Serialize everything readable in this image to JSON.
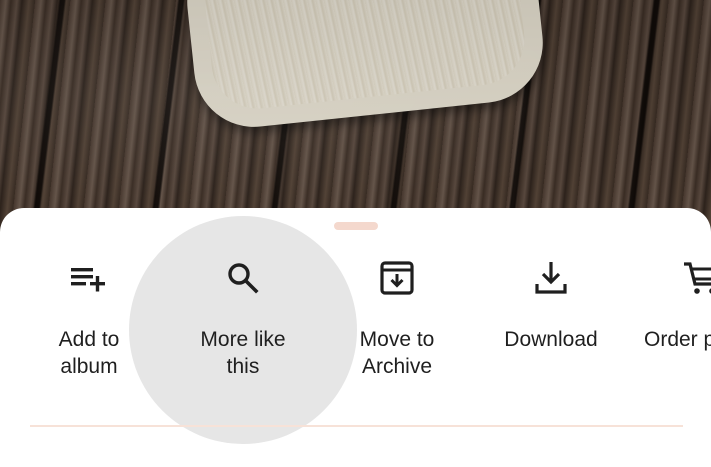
{
  "photo": {
    "description_icon": "photo-preview"
  },
  "sheet": {
    "actions": [
      {
        "label": "Add to\nalbum",
        "icon": "playlist-add-icon"
      },
      {
        "label": "More like\nthis",
        "icon": "search-icon"
      },
      {
        "label": "Move to\nArchive",
        "icon": "archive-icon"
      },
      {
        "label": "Download",
        "icon": "download-icon"
      },
      {
        "label": "Order p",
        "icon": "cart-icon"
      }
    ]
  },
  "colors": {
    "sheet_background": "#ffffff",
    "handle": "#f4d8cd",
    "ripple": "#e6e6e6",
    "divider": "#f7e2d8",
    "text": "#1f1f1f"
  }
}
